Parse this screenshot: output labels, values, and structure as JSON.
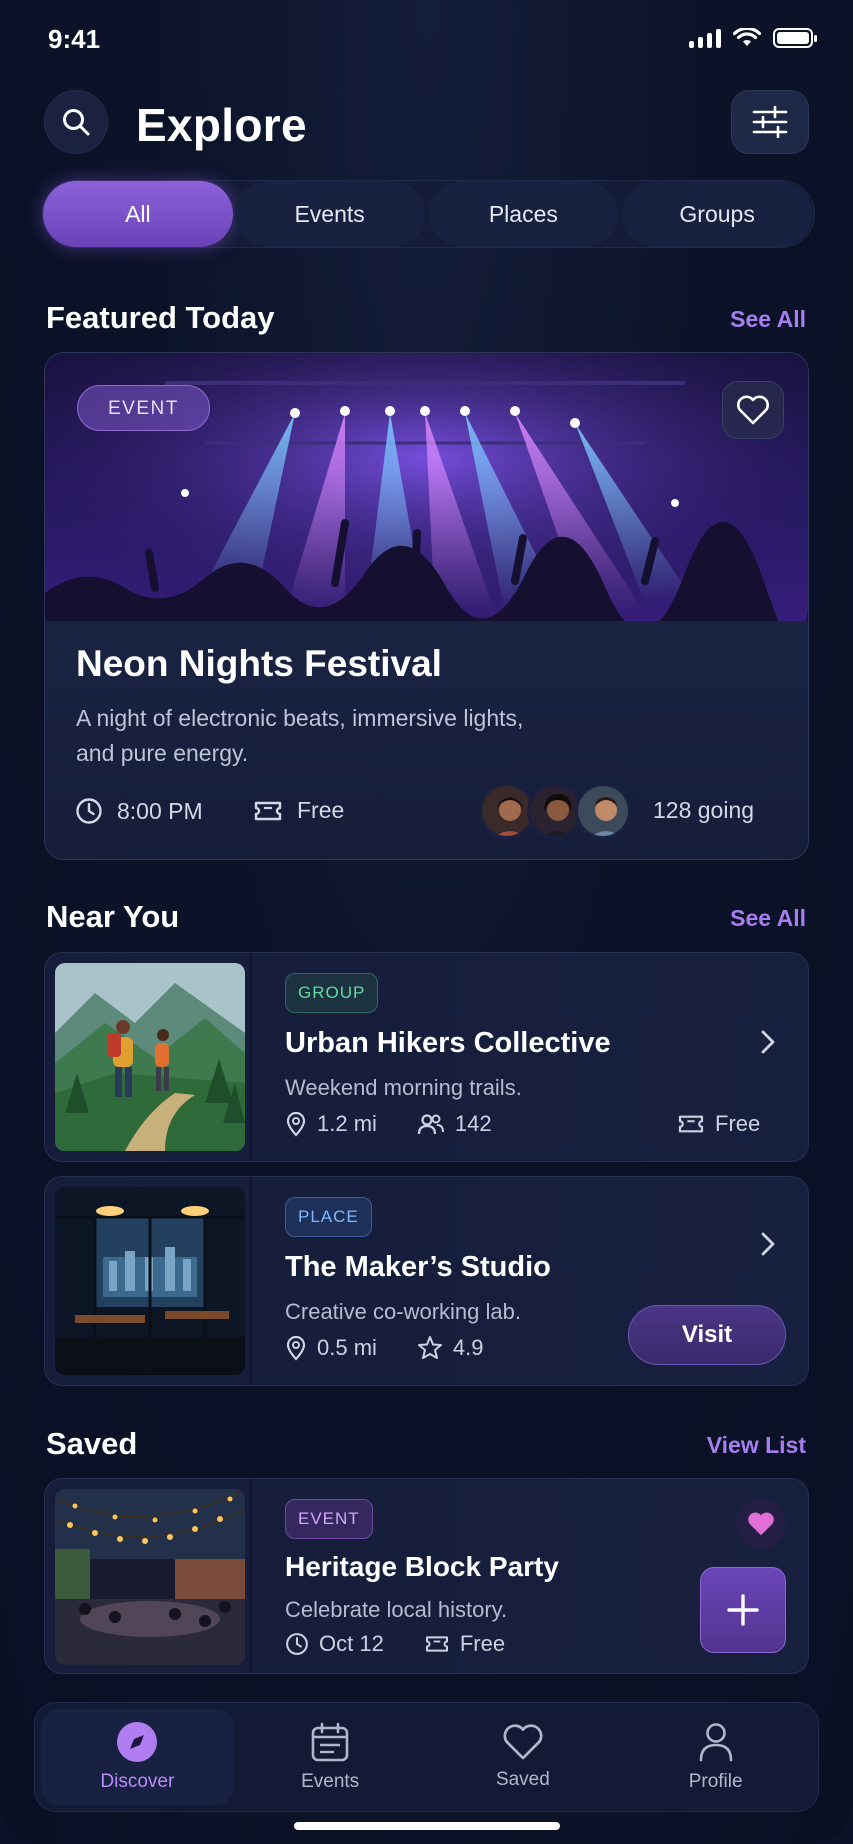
{
  "status": {
    "time": "9:41"
  },
  "header": {
    "title": "Explore"
  },
  "tabs": [
    {
      "label": "All",
      "active": true
    },
    {
      "label": "Events"
    },
    {
      "label": "Places"
    },
    {
      "label": "Groups"
    }
  ],
  "featured": {
    "section_title": "Featured Today",
    "see_all": "See All",
    "chip": "EVENT",
    "title": "Neon Nights Festival",
    "description": "A night of electronic beats, immersive lights, and pure energy.",
    "time": "8:00 PM",
    "price": "Free",
    "going": "128 going"
  },
  "near_you": {
    "section_title": "Near You",
    "see_all": "See All",
    "items": [
      {
        "chip": "GROUP",
        "title": "Urban Hikers Collective",
        "description": "Weekend morning trails.",
        "distance": "1.2 mi",
        "members": "142",
        "price": "Free"
      },
      {
        "chip": "PLACE",
        "title": "The Maker’s Studio",
        "description": "Creative co-working lab.",
        "distance": "0.5 mi",
        "rating": "4.9",
        "action": "Visit"
      }
    ]
  },
  "saved": {
    "section_title": "Saved",
    "view_list": "View List",
    "items": [
      {
        "chip": "EVENT",
        "title": "Heritage Block Party",
        "description": "Celebrate local history.",
        "date": "Oct 12",
        "price": "Free"
      }
    ]
  },
  "nav": [
    {
      "label": "Discover",
      "icon": "compass-icon",
      "active": true
    },
    {
      "label": "Events",
      "icon": "calendar-icon"
    },
    {
      "label": "Saved",
      "icon": "heart-icon"
    },
    {
      "label": "Profile",
      "icon": "user-icon"
    }
  ],
  "colors": {
    "accent": "#a67ef0",
    "background": "#0c1328",
    "pink": "#e66fd2"
  }
}
